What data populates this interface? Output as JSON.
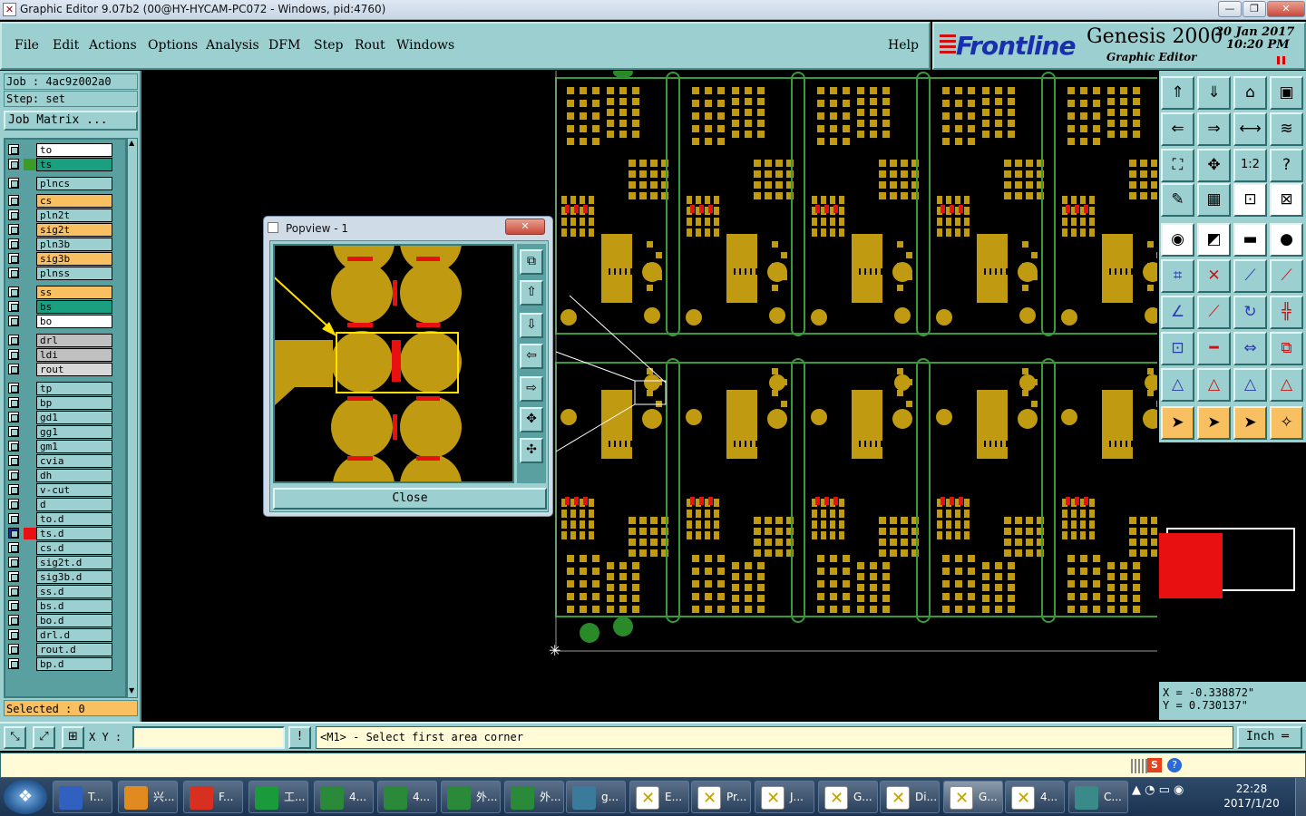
{
  "window": {
    "title": "Graphic Editor 9.07b2 (00@HY-HYCAM-PC072 - Windows, pid:4760)",
    "min": "—",
    "max": "❐",
    "close": "✕"
  },
  "menu": {
    "items": [
      "File",
      "Edit",
      "Actions",
      "Options",
      "Analysis",
      "DFM",
      "Step",
      "Rout",
      "Windows"
    ],
    "help": "Help"
  },
  "brand": {
    "logo": "Frontline",
    "product": "Genesis 2000",
    "subtitle": "Graphic Editor",
    "date": "20  Jan  2017",
    "time": "10:20  PM"
  },
  "job": {
    "job_label": "Job  :  4ac9z002a0",
    "step_label": "Step:  set",
    "matrix_button": "Job Matrix ..."
  },
  "layers": [
    {
      "name": "to",
      "bg": "#ffffff",
      "mid": ""
    },
    {
      "name": "ts",
      "bg": "#1aa080",
      "mid": "#3a9a2a"
    },
    {
      "name": "plncs",
      "bg": "#9ccfcf",
      "mid": ""
    },
    {
      "name": "cs",
      "bg": "#f8c060",
      "mid": ""
    },
    {
      "name": "pln2t",
      "bg": "#9ccfcf",
      "mid": ""
    },
    {
      "name": "sig2t",
      "bg": "#f8c060",
      "mid": ""
    },
    {
      "name": "pln3b",
      "bg": "#9ccfcf",
      "mid": ""
    },
    {
      "name": "sig3b",
      "bg": "#f8c060",
      "mid": ""
    },
    {
      "name": "plnss",
      "bg": "#9ccfcf",
      "mid": ""
    },
    {
      "name": "ss",
      "bg": "#f8c060",
      "mid": ""
    },
    {
      "name": "bs",
      "bg": "#1aa080",
      "mid": ""
    },
    {
      "name": "bo",
      "bg": "#ffffff",
      "mid": ""
    },
    {
      "name": "drl",
      "bg": "#c0c0c0",
      "mid": ""
    },
    {
      "name": "ldi",
      "bg": "#c0c0c0",
      "mid": ""
    },
    {
      "name": "rout",
      "bg": "#d8d8d8",
      "mid": ""
    },
    {
      "name": "tp",
      "bg": "#9ccfcf",
      "mid": ""
    },
    {
      "name": "bp",
      "bg": "#9ccfcf",
      "mid": ""
    },
    {
      "name": "gd1",
      "bg": "#9ccfcf",
      "mid": ""
    },
    {
      "name": "gg1",
      "bg": "#9ccfcf",
      "mid": ""
    },
    {
      "name": "gm1",
      "bg": "#9ccfcf",
      "mid": ""
    },
    {
      "name": "cvia",
      "bg": "#9ccfcf",
      "mid": ""
    },
    {
      "name": "dh",
      "bg": "#9ccfcf",
      "mid": ""
    },
    {
      "name": "v-cut",
      "bg": "#9ccfcf",
      "mid": ""
    },
    {
      "name": "d",
      "bg": "#9ccfcf",
      "mid": ""
    },
    {
      "name": "to.d",
      "bg": "#9ccfcf",
      "mid": ""
    },
    {
      "name": "ts.d",
      "bg": "#9ccfcf",
      "mid": "#e81010",
      "active": true
    },
    {
      "name": "cs.d",
      "bg": "#9ccfcf",
      "mid": ""
    },
    {
      "name": "sig2t.d",
      "bg": "#9ccfcf",
      "mid": ""
    },
    {
      "name": "sig3b.d",
      "bg": "#9ccfcf",
      "mid": ""
    },
    {
      "name": "ss.d",
      "bg": "#9ccfcf",
      "mid": ""
    },
    {
      "name": "bs.d",
      "bg": "#9ccfcf",
      "mid": ""
    },
    {
      "name": "bo.d",
      "bg": "#9ccfcf",
      "mid": ""
    },
    {
      "name": "drl.d",
      "bg": "#9ccfcf",
      "mid": ""
    },
    {
      "name": "rout.d",
      "bg": "#9ccfcf",
      "mid": ""
    },
    {
      "name": "bp.d",
      "bg": "#9ccfcf",
      "mid": ""
    }
  ],
  "selected": "Selected : 0",
  "popview": {
    "title": "Popview - 1",
    "close_label": "Close",
    "close_x": "✕"
  },
  "coords": {
    "x": "X = -0.338872\"",
    "y": "Y = 0.730137\""
  },
  "status": {
    "xy_label": "X Y :",
    "xy_value": "",
    "message": "<M1> - Select first area corner",
    "unit": "Inch ═",
    "warn": "!"
  },
  "colors": {
    "copper": "#c09a10",
    "panel": "#9ccfcf",
    "outline": "#3a9a3a",
    "red": "#e81010"
  },
  "taskbar": {
    "apps": [
      "T...",
      "兴...",
      "F...",
      "工...",
      "4...",
      "4...",
      "外...",
      "外...",
      "g...",
      "E...",
      "Pr...",
      "J...",
      "G...",
      "Di...",
      "G...",
      "4...",
      "C..."
    ],
    "time": "22:28",
    "date": "2017/1/20"
  }
}
